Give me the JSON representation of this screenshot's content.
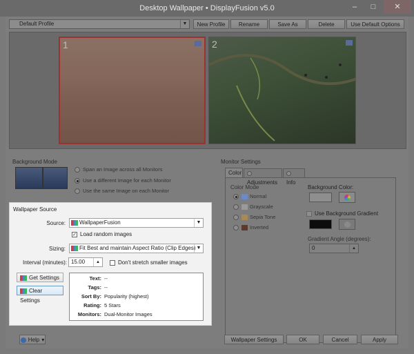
{
  "window": {
    "title": "Desktop Wallpaper • DisplayFusion v5.0",
    "minimize": "–",
    "maximize": "□",
    "close": "✕"
  },
  "profile_bar": {
    "profile_value": "Default Profile",
    "new_profile": "New Profile",
    "rename": "Rename",
    "save_as": "Save As",
    "delete": "Delete",
    "use_default_options": "Use Default Options"
  },
  "monitors": [
    {
      "number": "1",
      "selected": true
    },
    {
      "number": "2",
      "selected": false
    }
  ],
  "background_mode": {
    "label": "Background Mode",
    "options": [
      {
        "label": "Span an Image across all Monitors",
        "selected": false
      },
      {
        "label": "Use a different Image for each Monitor",
        "selected": true
      },
      {
        "label": "Use the same Image on each Monitor",
        "selected": false
      }
    ]
  },
  "monitor_settings": {
    "label": "Monitor Settings",
    "tabs": [
      "Color",
      "Adjustments",
      "Info"
    ],
    "color_mode_label": "Color Mode",
    "color_modes": [
      {
        "label": "Normal",
        "selected": true
      },
      {
        "label": "Grayscale",
        "selected": false
      },
      {
        "label": "Sepia Tone",
        "selected": false
      },
      {
        "label": "Inverted",
        "selected": false
      }
    ],
    "background_color_label": "Background Color:",
    "use_gradient_label": "Use Background Gradient",
    "gradient_angle_label": "Gradient Angle (degrees):",
    "gradient_angle_value": "0",
    "background_color": "#8e8e8e",
    "gradient_color": "#0c0c0c"
  },
  "wallpaper_source": {
    "label": "Wallpaper Source",
    "source_label": "Source:",
    "source_value": "WallpaperFusion",
    "load_random_label": "Load random images",
    "load_random_checked": true,
    "sizing_label": "Sizing:",
    "sizing_value": "Fit Best and maintain Aspect Ratio (Clip Edges)",
    "interval_label": "Interval (minutes):",
    "interval_value": "15.00",
    "dont_stretch_label": "Don't stretch smaller images",
    "dont_stretch_checked": false,
    "get_settings": "Get Settings",
    "clear_settings": "Clear Settings",
    "info": [
      {
        "key": "Text:",
        "value": "--"
      },
      {
        "key": "Tags:",
        "value": "--"
      },
      {
        "key": "Sort By:",
        "value": "Popularity (highest)"
      },
      {
        "key": "Rating:",
        "value": "5 Stars"
      },
      {
        "key": "Monitors:",
        "value": "Dual-Monitor Images"
      }
    ]
  },
  "footer": {
    "help": "Help",
    "wallpaper_settings": "Wallpaper Settings",
    "ok": "OK",
    "cancel": "Cancel",
    "apply": "Apply"
  }
}
